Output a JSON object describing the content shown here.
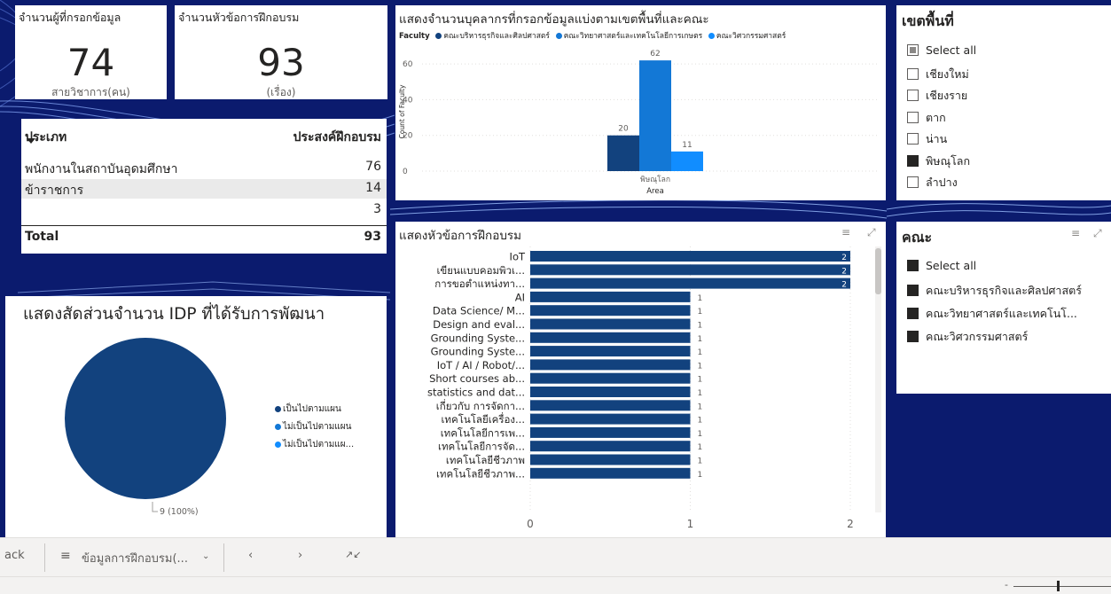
{
  "kpi": [
    {
      "title": "จำนวนผู้ที่กรอกข้อมูล",
      "value": "74",
      "subtitle": "สายวิชาการ(คน)"
    },
    {
      "title": "จำนวนหัวข้อการฝึกอบรม",
      "value": "93",
      "subtitle": "(เรื่อง)"
    }
  ],
  "matrix": {
    "col1": "ประเภท",
    "col2": "ประสงค์ฝึกอบรม",
    "rows": [
      {
        "label": "พนักงานในสถาบันอุดมศึกษา",
        "value": "76"
      },
      {
        "label": "ข้าราชการ",
        "value": "14"
      },
      {
        "label": "",
        "value": "3"
      }
    ],
    "total_label": "Total",
    "total_value": "93"
  },
  "faculty_chart": {
    "title": "แสดงจำนวนบุคลากรที่กรอกข้อมูลแบ่งตามเขตพื้นที่และคณะ",
    "legend_label": "Faculty",
    "legend": [
      {
        "name": "คณะบริหารธุรกิจและศิลปศาสตร์",
        "color": "#12427e"
      },
      {
        "name": "คณะวิทยาศาสตร์และเทคโนโลยีการเกษตร",
        "color": "#1378d6"
      },
      {
        "name": "คณะวิศวกรรมศาสตร์",
        "color": "#118dff"
      }
    ]
  },
  "pie_chart": {
    "title": "แสดงสัดส่วนจำนวน IDP ที่ได้รับการพัฒนา",
    "legend": [
      {
        "name": "เป็นไปตามแผน",
        "color": "#12427e"
      },
      {
        "name": "ไม่เป็นไปตามแผน",
        "color": "#1378d6"
      },
      {
        "name": "ไม่เป็นไปตามแผ...",
        "color": "#118dff"
      }
    ],
    "slice_label": "9 (100%)"
  },
  "training_chart": {
    "title": "แสดงหัวข้อการฝึกอบรม"
  },
  "area_slicer": {
    "title": "เขตพื้นที่",
    "items": [
      {
        "label": "Select all",
        "state": "partial"
      },
      {
        "label": "เชียงใหม่",
        "state": "empty"
      },
      {
        "label": "เชียงราย",
        "state": "empty"
      },
      {
        "label": "ตาก",
        "state": "empty"
      },
      {
        "label": "น่าน",
        "state": "empty"
      },
      {
        "label": "พิษณุโลก",
        "state": "filled"
      },
      {
        "label": "ลำปาง",
        "state": "empty"
      }
    ]
  },
  "faculty_slicer": {
    "title": "คณะ",
    "items": [
      {
        "label": "Select all",
        "state": "filled"
      },
      {
        "label": "คณะบริหารธุรกิจและศิลปศาสตร์",
        "state": "filled"
      },
      {
        "label": "คณะวิทยาศาสตร์และเทคโนโ...",
        "state": "filled"
      },
      {
        "label": "คณะวิศวกรรมศาสตร์",
        "state": "filled"
      }
    ]
  },
  "tabbar": {
    "back_label": "ack",
    "page_label": "ข้อมูลการฝึกอบรม(...",
    "prev_icon": "chevron-left-icon",
    "next_icon": "chevron-right-icon",
    "collapse_icon": "collapse-icon"
  },
  "chart_data": [
    {
      "type": "bar",
      "title": "แสดงจำนวนบุคลากรที่กรอกข้อมูลแบ่งตามเขตพื้นที่และคณะ",
      "xlabel": "Area",
      "ylabel": "Count of Faculty",
      "categories": [
        "พิษณุโลก"
      ],
      "series": [
        {
          "name": "คณะบริหารธุรกิจและศิลปศาสตร์",
          "values": [
            20
          ],
          "color": "#12427e"
        },
        {
          "name": "คณะวิทยาศาสตร์และเทคโนโลยีการเกษตร",
          "values": [
            62
          ],
          "color": "#1378d6"
        },
        {
          "name": "คณะวิศวกรรมศาสตร์",
          "values": [
            11
          ],
          "color": "#118dff"
        }
      ],
      "yticks": [
        0,
        20,
        40,
        60
      ],
      "ylim": [
        0,
        70
      ],
      "legend_position": "top-left",
      "grid": true
    },
    {
      "type": "pie",
      "title": "แสดงสัดส่วนจำนวน IDP ที่ได้รับการพัฒนา",
      "slices": [
        {
          "name": "เป็นไปตามแผน",
          "value": 9,
          "color": "#12427e"
        }
      ],
      "legend_position": "right"
    },
    {
      "type": "bar",
      "orientation": "horizontal",
      "title": "แสดงหัวข้อการฝึกอบรม",
      "categories": [
        "IoT",
        "เขียนแบบคอมพิวเ...",
        "การขอตำแหน่งทา...",
        "AI",
        "Data Science/ M...",
        "Design and eval...",
        "Grounding Syste...",
        "Grounding Syste...",
        "IoT / AI / Robot/...",
        "Short courses ab...",
        "statistics and dat...",
        "เกี่ยวกับ การจัดกา...",
        "เทคโนโลยีเครื่อง...",
        "เทคโนโลยีการเพ...",
        "เทคโนโลยีการจัด...",
        "เทคโนโลยีชีวภาพ",
        "เทคโนโลยีชีวภาพ..."
      ],
      "values": [
        2,
        2,
        2,
        1,
        1,
        1,
        1,
        1,
        1,
        1,
        1,
        1,
        1,
        1,
        1,
        1,
        1
      ],
      "xticks": [
        0,
        1,
        2
      ],
      "xlim": [
        0,
        2.05
      ],
      "color": "#12427e"
    }
  ]
}
